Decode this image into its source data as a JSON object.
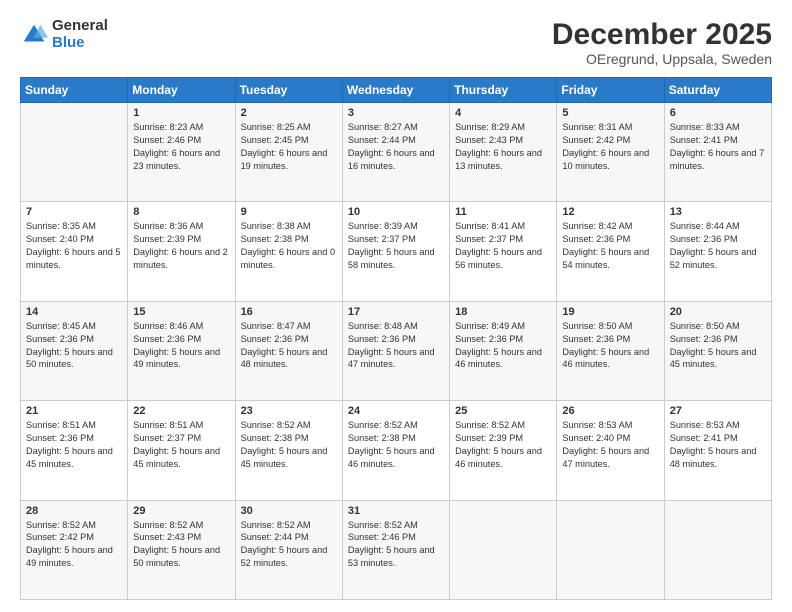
{
  "logo": {
    "general": "General",
    "blue": "Blue"
  },
  "title": "December 2025",
  "location": "OEregrund, Uppsala, Sweden",
  "days_of_week": [
    "Sunday",
    "Monday",
    "Tuesday",
    "Wednesday",
    "Thursday",
    "Friday",
    "Saturday"
  ],
  "weeks": [
    [
      {
        "day": "",
        "sunrise": "",
        "sunset": "",
        "daylight": ""
      },
      {
        "day": "1",
        "sunrise": "Sunrise: 8:23 AM",
        "sunset": "Sunset: 2:46 PM",
        "daylight": "Daylight: 6 hours and 23 minutes."
      },
      {
        "day": "2",
        "sunrise": "Sunrise: 8:25 AM",
        "sunset": "Sunset: 2:45 PM",
        "daylight": "Daylight: 6 hours and 19 minutes."
      },
      {
        "day": "3",
        "sunrise": "Sunrise: 8:27 AM",
        "sunset": "Sunset: 2:44 PM",
        "daylight": "Daylight: 6 hours and 16 minutes."
      },
      {
        "day": "4",
        "sunrise": "Sunrise: 8:29 AM",
        "sunset": "Sunset: 2:43 PM",
        "daylight": "Daylight: 6 hours and 13 minutes."
      },
      {
        "day": "5",
        "sunrise": "Sunrise: 8:31 AM",
        "sunset": "Sunset: 2:42 PM",
        "daylight": "Daylight: 6 hours and 10 minutes."
      },
      {
        "day": "6",
        "sunrise": "Sunrise: 8:33 AM",
        "sunset": "Sunset: 2:41 PM",
        "daylight": "Daylight: 6 hours and 7 minutes."
      }
    ],
    [
      {
        "day": "7",
        "sunrise": "Sunrise: 8:35 AM",
        "sunset": "Sunset: 2:40 PM",
        "daylight": "Daylight: 6 hours and 5 minutes."
      },
      {
        "day": "8",
        "sunrise": "Sunrise: 8:36 AM",
        "sunset": "Sunset: 2:39 PM",
        "daylight": "Daylight: 6 hours and 2 minutes."
      },
      {
        "day": "9",
        "sunrise": "Sunrise: 8:38 AM",
        "sunset": "Sunset: 2:38 PM",
        "daylight": "Daylight: 6 hours and 0 minutes."
      },
      {
        "day": "10",
        "sunrise": "Sunrise: 8:39 AM",
        "sunset": "Sunset: 2:37 PM",
        "daylight": "Daylight: 5 hours and 58 minutes."
      },
      {
        "day": "11",
        "sunrise": "Sunrise: 8:41 AM",
        "sunset": "Sunset: 2:37 PM",
        "daylight": "Daylight: 5 hours and 56 minutes."
      },
      {
        "day": "12",
        "sunrise": "Sunrise: 8:42 AM",
        "sunset": "Sunset: 2:36 PM",
        "daylight": "Daylight: 5 hours and 54 minutes."
      },
      {
        "day": "13",
        "sunrise": "Sunrise: 8:44 AM",
        "sunset": "Sunset: 2:36 PM",
        "daylight": "Daylight: 5 hours and 52 minutes."
      }
    ],
    [
      {
        "day": "14",
        "sunrise": "Sunrise: 8:45 AM",
        "sunset": "Sunset: 2:36 PM",
        "daylight": "Daylight: 5 hours and 50 minutes."
      },
      {
        "day": "15",
        "sunrise": "Sunrise: 8:46 AM",
        "sunset": "Sunset: 2:36 PM",
        "daylight": "Daylight: 5 hours and 49 minutes."
      },
      {
        "day": "16",
        "sunrise": "Sunrise: 8:47 AM",
        "sunset": "Sunset: 2:36 PM",
        "daylight": "Daylight: 5 hours and 48 minutes."
      },
      {
        "day": "17",
        "sunrise": "Sunrise: 8:48 AM",
        "sunset": "Sunset: 2:36 PM",
        "daylight": "Daylight: 5 hours and 47 minutes."
      },
      {
        "day": "18",
        "sunrise": "Sunrise: 8:49 AM",
        "sunset": "Sunset: 2:36 PM",
        "daylight": "Daylight: 5 hours and 46 minutes."
      },
      {
        "day": "19",
        "sunrise": "Sunrise: 8:50 AM",
        "sunset": "Sunset: 2:36 PM",
        "daylight": "Daylight: 5 hours and 46 minutes."
      },
      {
        "day": "20",
        "sunrise": "Sunrise: 8:50 AM",
        "sunset": "Sunset: 2:36 PM",
        "daylight": "Daylight: 5 hours and 45 minutes."
      }
    ],
    [
      {
        "day": "21",
        "sunrise": "Sunrise: 8:51 AM",
        "sunset": "Sunset: 2:36 PM",
        "daylight": "Daylight: 5 hours and 45 minutes."
      },
      {
        "day": "22",
        "sunrise": "Sunrise: 8:51 AM",
        "sunset": "Sunset: 2:37 PM",
        "daylight": "Daylight: 5 hours and 45 minutes."
      },
      {
        "day": "23",
        "sunrise": "Sunrise: 8:52 AM",
        "sunset": "Sunset: 2:38 PM",
        "daylight": "Daylight: 5 hours and 45 minutes."
      },
      {
        "day": "24",
        "sunrise": "Sunrise: 8:52 AM",
        "sunset": "Sunset: 2:38 PM",
        "daylight": "Daylight: 5 hours and 46 minutes."
      },
      {
        "day": "25",
        "sunrise": "Sunrise: 8:52 AM",
        "sunset": "Sunset: 2:39 PM",
        "daylight": "Daylight: 5 hours and 46 minutes."
      },
      {
        "day": "26",
        "sunrise": "Sunrise: 8:53 AM",
        "sunset": "Sunset: 2:40 PM",
        "daylight": "Daylight: 5 hours and 47 minutes."
      },
      {
        "day": "27",
        "sunrise": "Sunrise: 8:53 AM",
        "sunset": "Sunset: 2:41 PM",
        "daylight": "Daylight: 5 hours and 48 minutes."
      }
    ],
    [
      {
        "day": "28",
        "sunrise": "Sunrise: 8:52 AM",
        "sunset": "Sunset: 2:42 PM",
        "daylight": "Daylight: 5 hours and 49 minutes."
      },
      {
        "day": "29",
        "sunrise": "Sunrise: 8:52 AM",
        "sunset": "Sunset: 2:43 PM",
        "daylight": "Daylight: 5 hours and 50 minutes."
      },
      {
        "day": "30",
        "sunrise": "Sunrise: 8:52 AM",
        "sunset": "Sunset: 2:44 PM",
        "daylight": "Daylight: 5 hours and 52 minutes."
      },
      {
        "day": "31",
        "sunrise": "Sunrise: 8:52 AM",
        "sunset": "Sunset: 2:46 PM",
        "daylight": "Daylight: 5 hours and 53 minutes."
      },
      {
        "day": "",
        "sunrise": "",
        "sunset": "",
        "daylight": ""
      },
      {
        "day": "",
        "sunrise": "",
        "sunset": "",
        "daylight": ""
      },
      {
        "day": "",
        "sunrise": "",
        "sunset": "",
        "daylight": ""
      }
    ]
  ]
}
